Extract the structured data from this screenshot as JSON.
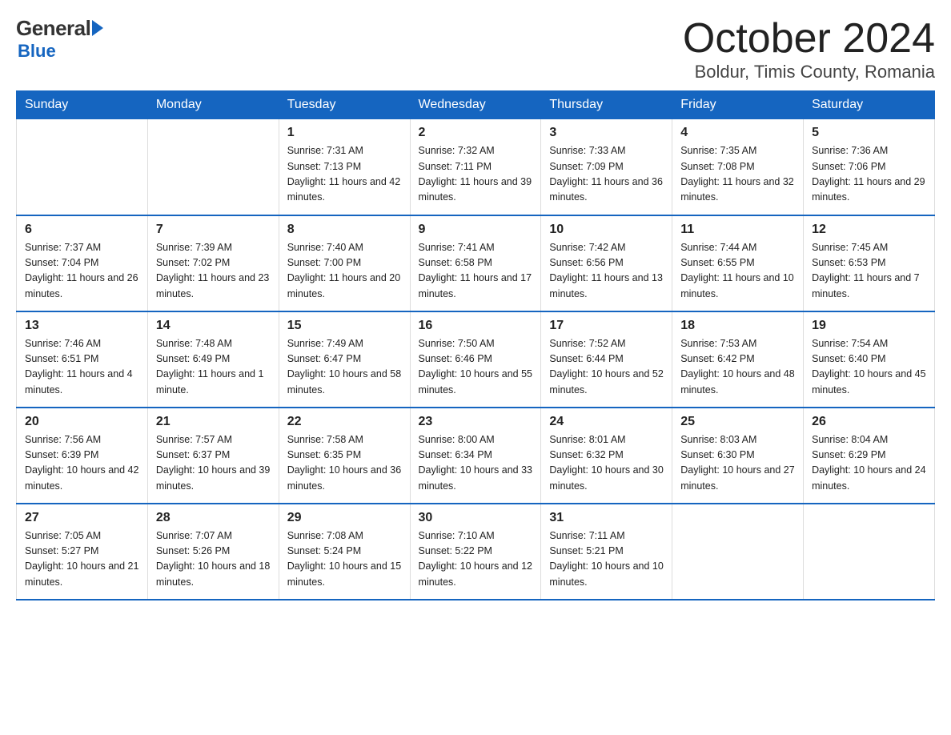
{
  "logo": {
    "general": "General",
    "blue": "Blue"
  },
  "title": "October 2024",
  "location": "Boldur, Timis County, Romania",
  "headers": [
    "Sunday",
    "Monday",
    "Tuesday",
    "Wednesday",
    "Thursday",
    "Friday",
    "Saturday"
  ],
  "weeks": [
    [
      {
        "day": "",
        "sunrise": "",
        "sunset": "",
        "daylight": ""
      },
      {
        "day": "",
        "sunrise": "",
        "sunset": "",
        "daylight": ""
      },
      {
        "day": "1",
        "sunrise": "Sunrise: 7:31 AM",
        "sunset": "Sunset: 7:13 PM",
        "daylight": "Daylight: 11 hours and 42 minutes."
      },
      {
        "day": "2",
        "sunrise": "Sunrise: 7:32 AM",
        "sunset": "Sunset: 7:11 PM",
        "daylight": "Daylight: 11 hours and 39 minutes."
      },
      {
        "day": "3",
        "sunrise": "Sunrise: 7:33 AM",
        "sunset": "Sunset: 7:09 PM",
        "daylight": "Daylight: 11 hours and 36 minutes."
      },
      {
        "day": "4",
        "sunrise": "Sunrise: 7:35 AM",
        "sunset": "Sunset: 7:08 PM",
        "daylight": "Daylight: 11 hours and 32 minutes."
      },
      {
        "day": "5",
        "sunrise": "Sunrise: 7:36 AM",
        "sunset": "Sunset: 7:06 PM",
        "daylight": "Daylight: 11 hours and 29 minutes."
      }
    ],
    [
      {
        "day": "6",
        "sunrise": "Sunrise: 7:37 AM",
        "sunset": "Sunset: 7:04 PM",
        "daylight": "Daylight: 11 hours and 26 minutes."
      },
      {
        "day": "7",
        "sunrise": "Sunrise: 7:39 AM",
        "sunset": "Sunset: 7:02 PM",
        "daylight": "Daylight: 11 hours and 23 minutes."
      },
      {
        "day": "8",
        "sunrise": "Sunrise: 7:40 AM",
        "sunset": "Sunset: 7:00 PM",
        "daylight": "Daylight: 11 hours and 20 minutes."
      },
      {
        "day": "9",
        "sunrise": "Sunrise: 7:41 AM",
        "sunset": "Sunset: 6:58 PM",
        "daylight": "Daylight: 11 hours and 17 minutes."
      },
      {
        "day": "10",
        "sunrise": "Sunrise: 7:42 AM",
        "sunset": "Sunset: 6:56 PM",
        "daylight": "Daylight: 11 hours and 13 minutes."
      },
      {
        "day": "11",
        "sunrise": "Sunrise: 7:44 AM",
        "sunset": "Sunset: 6:55 PM",
        "daylight": "Daylight: 11 hours and 10 minutes."
      },
      {
        "day": "12",
        "sunrise": "Sunrise: 7:45 AM",
        "sunset": "Sunset: 6:53 PM",
        "daylight": "Daylight: 11 hours and 7 minutes."
      }
    ],
    [
      {
        "day": "13",
        "sunrise": "Sunrise: 7:46 AM",
        "sunset": "Sunset: 6:51 PM",
        "daylight": "Daylight: 11 hours and 4 minutes."
      },
      {
        "day": "14",
        "sunrise": "Sunrise: 7:48 AM",
        "sunset": "Sunset: 6:49 PM",
        "daylight": "Daylight: 11 hours and 1 minute."
      },
      {
        "day": "15",
        "sunrise": "Sunrise: 7:49 AM",
        "sunset": "Sunset: 6:47 PM",
        "daylight": "Daylight: 10 hours and 58 minutes."
      },
      {
        "day": "16",
        "sunrise": "Sunrise: 7:50 AM",
        "sunset": "Sunset: 6:46 PM",
        "daylight": "Daylight: 10 hours and 55 minutes."
      },
      {
        "day": "17",
        "sunrise": "Sunrise: 7:52 AM",
        "sunset": "Sunset: 6:44 PM",
        "daylight": "Daylight: 10 hours and 52 minutes."
      },
      {
        "day": "18",
        "sunrise": "Sunrise: 7:53 AM",
        "sunset": "Sunset: 6:42 PM",
        "daylight": "Daylight: 10 hours and 48 minutes."
      },
      {
        "day": "19",
        "sunrise": "Sunrise: 7:54 AM",
        "sunset": "Sunset: 6:40 PM",
        "daylight": "Daylight: 10 hours and 45 minutes."
      }
    ],
    [
      {
        "day": "20",
        "sunrise": "Sunrise: 7:56 AM",
        "sunset": "Sunset: 6:39 PM",
        "daylight": "Daylight: 10 hours and 42 minutes."
      },
      {
        "day": "21",
        "sunrise": "Sunrise: 7:57 AM",
        "sunset": "Sunset: 6:37 PM",
        "daylight": "Daylight: 10 hours and 39 minutes."
      },
      {
        "day": "22",
        "sunrise": "Sunrise: 7:58 AM",
        "sunset": "Sunset: 6:35 PM",
        "daylight": "Daylight: 10 hours and 36 minutes."
      },
      {
        "day": "23",
        "sunrise": "Sunrise: 8:00 AM",
        "sunset": "Sunset: 6:34 PM",
        "daylight": "Daylight: 10 hours and 33 minutes."
      },
      {
        "day": "24",
        "sunrise": "Sunrise: 8:01 AM",
        "sunset": "Sunset: 6:32 PM",
        "daylight": "Daylight: 10 hours and 30 minutes."
      },
      {
        "day": "25",
        "sunrise": "Sunrise: 8:03 AM",
        "sunset": "Sunset: 6:30 PM",
        "daylight": "Daylight: 10 hours and 27 minutes."
      },
      {
        "day": "26",
        "sunrise": "Sunrise: 8:04 AM",
        "sunset": "Sunset: 6:29 PM",
        "daylight": "Daylight: 10 hours and 24 minutes."
      }
    ],
    [
      {
        "day": "27",
        "sunrise": "Sunrise: 7:05 AM",
        "sunset": "Sunset: 5:27 PM",
        "daylight": "Daylight: 10 hours and 21 minutes."
      },
      {
        "day": "28",
        "sunrise": "Sunrise: 7:07 AM",
        "sunset": "Sunset: 5:26 PM",
        "daylight": "Daylight: 10 hours and 18 minutes."
      },
      {
        "day": "29",
        "sunrise": "Sunrise: 7:08 AM",
        "sunset": "Sunset: 5:24 PM",
        "daylight": "Daylight: 10 hours and 15 minutes."
      },
      {
        "day": "30",
        "sunrise": "Sunrise: 7:10 AM",
        "sunset": "Sunset: 5:22 PM",
        "daylight": "Daylight: 10 hours and 12 minutes."
      },
      {
        "day": "31",
        "sunrise": "Sunrise: 7:11 AM",
        "sunset": "Sunset: 5:21 PM",
        "daylight": "Daylight: 10 hours and 10 minutes."
      },
      {
        "day": "",
        "sunrise": "",
        "sunset": "",
        "daylight": ""
      },
      {
        "day": "",
        "sunrise": "",
        "sunset": "",
        "daylight": ""
      }
    ]
  ]
}
